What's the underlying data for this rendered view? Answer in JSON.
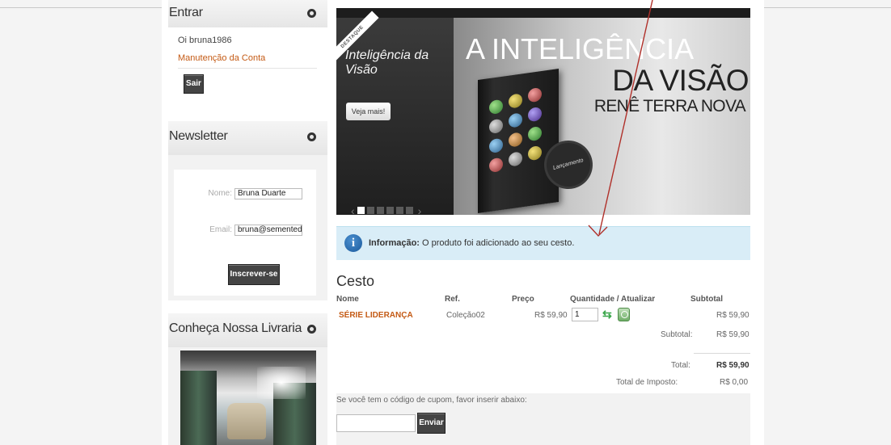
{
  "sidebar": {
    "login": {
      "title": "Entrar",
      "greeting": "Oi bruna1986",
      "manage_link": "Manutenção da Conta",
      "logout_label": "Sair"
    },
    "newsletter": {
      "title": "Newsletter",
      "name_label": "Nome:",
      "name_value": "Bruna Duarte",
      "email_label": "Email:",
      "email_value": "bruna@sementede",
      "subscribe_label": "Inscrever-se"
    },
    "store": {
      "title": "Conheça Nossa Livraria"
    }
  },
  "banner": {
    "ribbon": "DESTAQUE",
    "caption": "Inteligência da Visão",
    "more_label": "Veja mais!",
    "headline_1": "A INTELIGÊNCIA",
    "headline_2": "DA VISÃO",
    "author": "RENÊ TERRA NOVA",
    "seal": "Lançamento",
    "slide_count": 6,
    "active_slide": 1
  },
  "info": {
    "label": "Informação:",
    "message": "O produto foi adicionado ao seu cesto."
  },
  "cart": {
    "title": "Cesto",
    "headers": {
      "name": "Nome",
      "ref": "Ref.",
      "price": "Preço",
      "qty": "Quantidade / Atualizar",
      "subtotal": "Subtotal"
    },
    "items": [
      {
        "name": "SÉRIE LIDERANÇA",
        "ref": "Coleção02",
        "price": "R$ 59,90",
        "qty": "1",
        "subtotal": "R$ 59,90"
      }
    ],
    "subtotal_label": "Subtotal:",
    "subtotal_value": "R$ 59,90",
    "total_label": "Total:",
    "total_value": "R$ 59,90",
    "tax_label": "Total de Imposto:",
    "tax_value": "R$ 0,00"
  },
  "coupon": {
    "prompt": "Se você tem o código de cupom, favor inserir abaixo:",
    "submit_label": "Enviar"
  },
  "colors": {
    "accent_link": "#c45a14",
    "info_bg": "#d9edf7",
    "annotation_arrow": "#b0302a"
  }
}
